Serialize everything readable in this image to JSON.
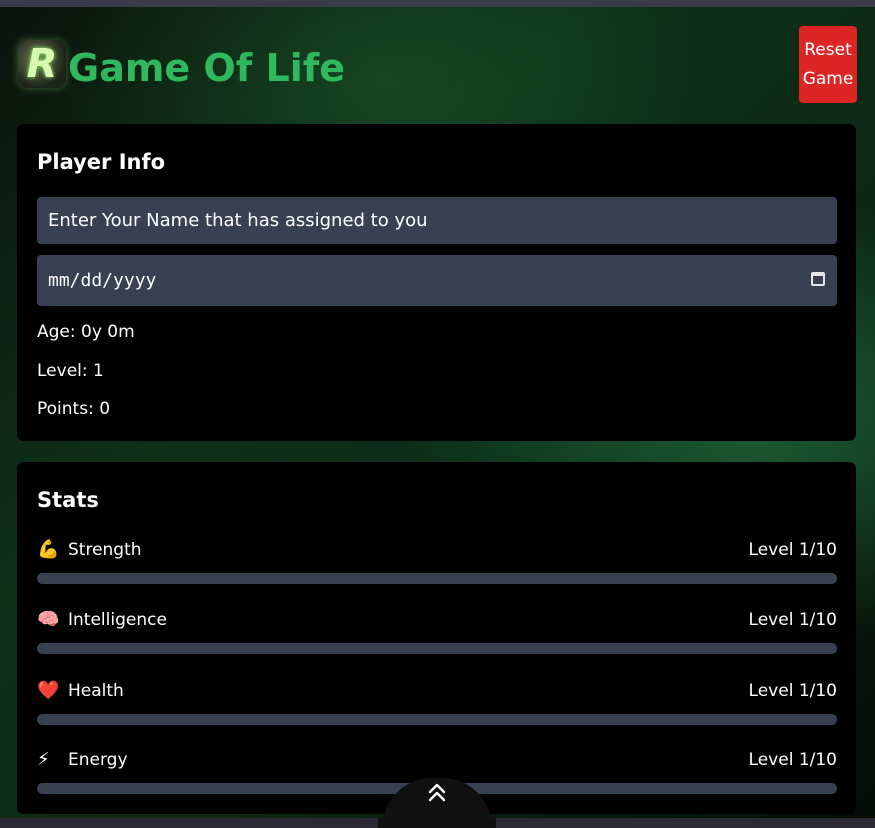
{
  "header": {
    "logo_letter": "R",
    "title": "Game Of Life",
    "reset_button": "Reset\nGame",
    "reset_color": "#dc2626",
    "title_color": "#2fb85e"
  },
  "player_info": {
    "title": "Player Info",
    "name_placeholder": "Enter Your Name that has assigned to you",
    "date_placeholder": "mm/dd/yyyy",
    "age": "Age: 0y 0m",
    "level": "Level: 1",
    "points": "Points: 0"
  },
  "stats": {
    "title": "Stats",
    "items": [
      {
        "icon": "flexed-biceps-icon",
        "emoji": "💪",
        "label": "Strength",
        "level": "Level 1/10",
        "progress": 0
      },
      {
        "icon": "brain-icon",
        "emoji": "🧠",
        "label": "Intelligence",
        "level": "Level 1/10",
        "progress": 0
      },
      {
        "icon": "heart-icon",
        "emoji": "❤️",
        "label": "Health",
        "level": "Level 1/10",
        "progress": 0
      },
      {
        "icon": "lightning-icon",
        "emoji": "⚡",
        "label": "Energy",
        "level": "Level 1/10",
        "progress": 0
      }
    ]
  },
  "scroll_top": {
    "icon": "double-chevron-up-icon"
  }
}
